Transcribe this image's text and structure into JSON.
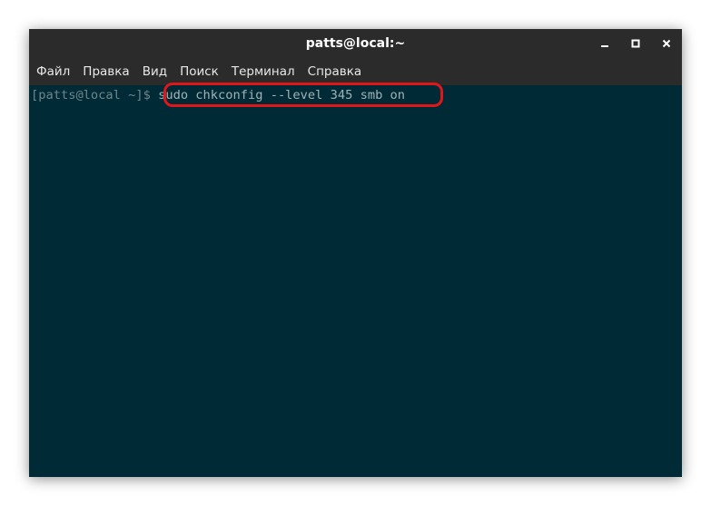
{
  "window": {
    "title": "patts@local:~"
  },
  "controls": {
    "minimize_icon": "minimize-icon",
    "maximize_icon": "maximize-icon",
    "close_icon": "close-icon"
  },
  "menu": {
    "items": [
      {
        "label": "Файл"
      },
      {
        "label": "Правка"
      },
      {
        "label": "Вид"
      },
      {
        "label": "Поиск"
      },
      {
        "label": "Терминал"
      },
      {
        "label": "Справка"
      }
    ]
  },
  "terminal": {
    "prompt": "[patts@local ~]$ ",
    "command": "sudo chkconfig --level 345 smb on",
    "background": "#002b36",
    "highlight_color": "#e0161b"
  }
}
